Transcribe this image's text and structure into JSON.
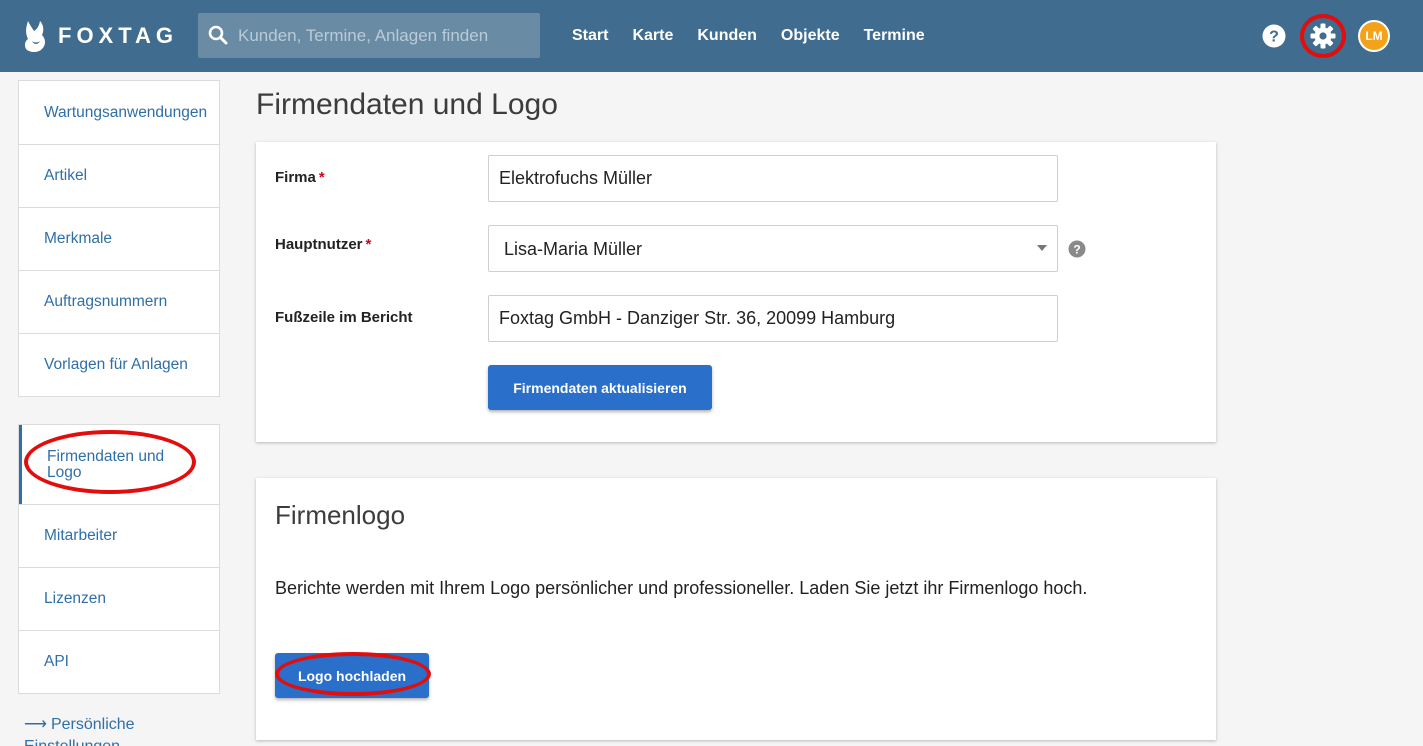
{
  "brand": {
    "name": "FOXTAG"
  },
  "search": {
    "placeholder": "Kunden, Termine, Anlagen finden"
  },
  "nav": {
    "items": [
      "Start",
      "Karte",
      "Kunden",
      "Objekte",
      "Termine"
    ]
  },
  "header": {
    "avatar_initials": "LM"
  },
  "sidebar": {
    "group1": [
      "Wartungsanwendungen",
      "Artikel",
      "Merkmale",
      "Auftragsnummern",
      "Vorlagen für Anlagen"
    ],
    "group2": [
      "Firmendaten und Logo",
      "Mitarbeiter",
      "Lizenzen",
      "API"
    ],
    "personal_link": "Persönliche Einstellungen"
  },
  "main": {
    "title": "Firmendaten und Logo",
    "company_form": {
      "firma_label": "Firma",
      "firma_value": "Elektrofuchs Müller",
      "hauptnutzer_label": "Hauptnutzer",
      "hauptnutzer_value": "Lisa-Maria Müller",
      "fusszeile_label": "Fußzeile im Bericht",
      "fusszeile_value": "Foxtag GmbH - Danziger Str. 36, 20099 Hamburg",
      "required_marker": "*",
      "update_button": "Firmendaten aktualisieren"
    },
    "logo_card": {
      "title": "Firmenlogo",
      "text": "Berichte werden mit Ihrem Logo persönlicher und professioneller. Laden Sie jetzt ihr Firmenlogo hoch.",
      "upload_button": "Logo hochladen"
    }
  },
  "colors": {
    "topbar": "#3f6c8f",
    "accent": "#2a6fc9",
    "link": "#2f6fa8",
    "annotation": "#e20d0d",
    "avatar": "#f4a21a"
  }
}
